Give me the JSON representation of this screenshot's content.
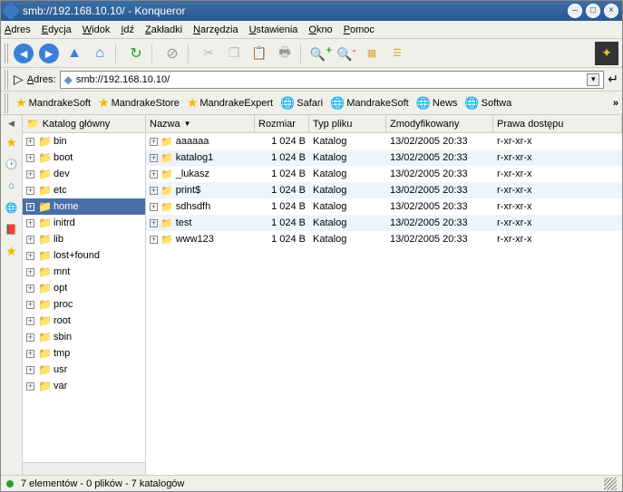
{
  "titlebar": {
    "text": "smb://192.168.10.10/ - Konqueror"
  },
  "menubar": [
    "Adres",
    "Edycja",
    "Widok",
    "Idź",
    "Zakładki",
    "Narzędzia",
    "Ustawienia",
    "Okno",
    "Pomoc"
  ],
  "addressbar": {
    "label": "Adres:",
    "value": "smb://192.168.10.10/"
  },
  "bookmarks": [
    {
      "icon": "star",
      "label": "MandrakeSoft"
    },
    {
      "icon": "star",
      "label": "MandrakeStore"
    },
    {
      "icon": "star",
      "label": "MandrakeExpert"
    },
    {
      "icon": "world",
      "label": "Safari"
    },
    {
      "icon": "world",
      "label": "MandrakeSoft"
    },
    {
      "icon": "world",
      "label": "News"
    },
    {
      "icon": "world",
      "label": "Softwa"
    }
  ],
  "bookmarks_overflow": "»",
  "tree": {
    "header": "Katalog główny",
    "items": [
      {
        "label": "bin",
        "selected": false
      },
      {
        "label": "boot",
        "selected": false
      },
      {
        "label": "dev",
        "selected": false
      },
      {
        "label": "etc",
        "selected": false
      },
      {
        "label": "home",
        "selected": true
      },
      {
        "label": "initrd",
        "selected": false
      },
      {
        "label": "lib",
        "selected": false
      },
      {
        "label": "lost+found",
        "selected": false
      },
      {
        "label": "mnt",
        "selected": false
      },
      {
        "label": "opt",
        "selected": false
      },
      {
        "label": "proc",
        "selected": false
      },
      {
        "label": "root",
        "selected": false
      },
      {
        "label": "sbin",
        "selected": false
      },
      {
        "label": "tmp",
        "selected": false
      },
      {
        "label": "usr",
        "selected": false
      },
      {
        "label": "var",
        "selected": false
      }
    ]
  },
  "columns": [
    "Nazwa",
    "Rozmiar",
    "Typ pliku",
    "Zmodyfikowany",
    "Prawa dostępu"
  ],
  "files": [
    {
      "name": "aaaaaa",
      "size": "1 024 B",
      "type": "Katalog",
      "modified": "13/02/2005 20:33",
      "perms": "r-xr-xr-x"
    },
    {
      "name": "katalog1",
      "size": "1 024 B",
      "type": "Katalog",
      "modified": "13/02/2005 20:33",
      "perms": "r-xr-xr-x"
    },
    {
      "name": "_lukasz",
      "size": "1 024 B",
      "type": "Katalog",
      "modified": "13/02/2005 20:33",
      "perms": "r-xr-xr-x"
    },
    {
      "name": "print$",
      "size": "1 024 B",
      "type": "Katalog",
      "modified": "13/02/2005 20:33",
      "perms": "r-xr-xr-x"
    },
    {
      "name": "sdhsdfh",
      "size": "1 024 B",
      "type": "Katalog",
      "modified": "13/02/2005 20:33",
      "perms": "r-xr-xr-x"
    },
    {
      "name": "test",
      "size": "1 024 B",
      "type": "Katalog",
      "modified": "13/02/2005 20:33",
      "perms": "r-xr-xr-x"
    },
    {
      "name": "www123",
      "size": "1 024 B",
      "type": "Katalog",
      "modified": "13/02/2005 20:33",
      "perms": "r-xr-xr-x"
    }
  ],
  "statusbar": {
    "text": "7 elementów - 0 plików - 7 katalogów"
  }
}
